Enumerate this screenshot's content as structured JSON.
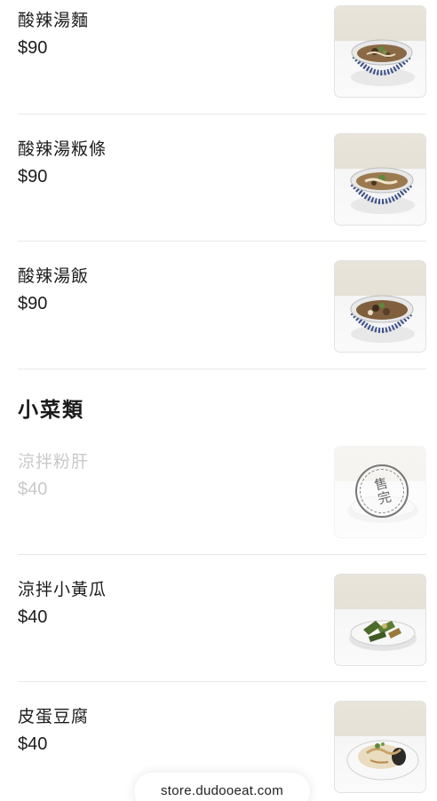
{
  "items": [
    {
      "name": "酸辣湯麵",
      "price": "$90",
      "image_icon": "hot-sour-soup-noodle-photo"
    },
    {
      "name": "酸辣湯粄條",
      "price": "$90",
      "image_icon": "hot-sour-soup-rice-noodle-photo"
    },
    {
      "name": "酸辣湯飯",
      "price": "$90",
      "image_icon": "hot-sour-soup-rice-photo"
    }
  ],
  "section": {
    "title": "小菜類"
  },
  "side_items": [
    {
      "name": "涼拌粉肝",
      "price": "$40",
      "sold_out": true,
      "sold_out_label": "售完",
      "image_icon": "cold-pork-liver-photo"
    },
    {
      "name": "涼拌小黃瓜",
      "price": "$40",
      "sold_out": false,
      "image_icon": "cucumber-salad-photo"
    },
    {
      "name": "皮蛋豆腐",
      "price": "$40",
      "sold_out": false,
      "image_icon": "century-egg-tofu-photo"
    }
  ],
  "footer": {
    "url": "store.dudooeat.com"
  },
  "colors": {
    "text": "#1c1c1c",
    "sold_out_text": "#c9c9c9",
    "divider": "#e8e8e8"
  }
}
